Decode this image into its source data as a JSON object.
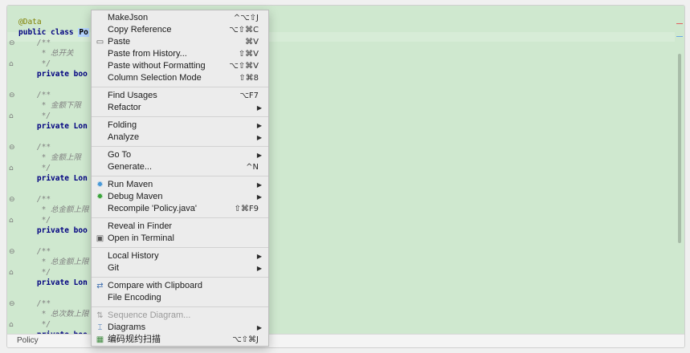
{
  "code": {
    "lines": [
      {
        "text": "@Data",
        "kind": "annotation"
      },
      {
        "text": "public class ",
        "kind": "kw",
        "highlight": "Po"
      },
      {
        "text": "    /**",
        "kind": "comment"
      },
      {
        "text": "     * 总开关",
        "kind": "comment"
      },
      {
        "text": "     */",
        "kind": "comment"
      },
      {
        "text": "    private boo",
        "kind": "kw"
      },
      {
        "text": "",
        "kind": "plain"
      },
      {
        "text": "    /**",
        "kind": "comment"
      },
      {
        "text": "     * 金额下限",
        "kind": "comment"
      },
      {
        "text": "     */",
        "kind": "comment"
      },
      {
        "text": "    private Lon",
        "kind": "kw"
      },
      {
        "text": "",
        "kind": "plain"
      },
      {
        "text": "    /**",
        "kind": "comment"
      },
      {
        "text": "     * 金额上限",
        "kind": "comment"
      },
      {
        "text": "     */",
        "kind": "comment"
      },
      {
        "text": "    private Lon",
        "kind": "kw"
      },
      {
        "text": "",
        "kind": "plain"
      },
      {
        "text": "    /**",
        "kind": "comment"
      },
      {
        "text": "     * 总金额上限",
        "kind": "comment"
      },
      {
        "text": "     */",
        "kind": "comment"
      },
      {
        "text": "    private boo",
        "kind": "kw"
      },
      {
        "text": "",
        "kind": "plain"
      },
      {
        "text": "    /**",
        "kind": "comment"
      },
      {
        "text": "     * 总金额上限",
        "kind": "comment"
      },
      {
        "text": "     */",
        "kind": "comment"
      },
      {
        "text": "    private Lon",
        "kind": "kw"
      },
      {
        "text": "",
        "kind": "plain"
      },
      {
        "text": "    /**",
        "kind": "comment"
      },
      {
        "text": "     * 总次数上限",
        "kind": "comment"
      },
      {
        "text": "     */",
        "kind": "comment"
      },
      {
        "text": "    private boo",
        "kind": "kw"
      }
    ]
  },
  "status": {
    "breadcrumb": "Policy"
  },
  "menu": {
    "items": [
      {
        "label": "MakeJson",
        "shortcut": "^⌥⇧J",
        "icon": ""
      },
      {
        "label": "Copy Reference",
        "shortcut": "⌥⇧⌘C",
        "icon": ""
      },
      {
        "label": "Paste",
        "shortcut": "⌘V",
        "icon": "clipboard-icon"
      },
      {
        "label": "Paste from History...",
        "shortcut": "⇧⌘V",
        "icon": ""
      },
      {
        "label": "Paste without Formatting",
        "shortcut": "⌥⇧⌘V",
        "icon": ""
      },
      {
        "label": "Column Selection Mode",
        "shortcut": "⇧⌘8",
        "icon": ""
      },
      {
        "sep": true
      },
      {
        "label": "Find Usages",
        "shortcut": "⌥F7",
        "icon": ""
      },
      {
        "label": "Refactor",
        "submenu": true,
        "icon": ""
      },
      {
        "sep": true
      },
      {
        "label": "Folding",
        "submenu": true,
        "icon": ""
      },
      {
        "label": "Analyze",
        "submenu": true,
        "icon": ""
      },
      {
        "sep": true
      },
      {
        "label": "Go To",
        "submenu": true,
        "icon": ""
      },
      {
        "label": "Generate...",
        "shortcut": "^N",
        "icon": ""
      },
      {
        "sep": true
      },
      {
        "label": "Run Maven",
        "submenu": true,
        "icon": "maven-run-icon"
      },
      {
        "label": "Debug Maven",
        "submenu": true,
        "icon": "maven-debug-icon"
      },
      {
        "label": "Recompile 'Policy.java'",
        "shortcut": "⇧⌘F9",
        "icon": ""
      },
      {
        "sep": true
      },
      {
        "label": "Reveal in Finder",
        "icon": ""
      },
      {
        "label": "Open in Terminal",
        "icon": "terminal-icon"
      },
      {
        "sep": true
      },
      {
        "label": "Local History",
        "submenu": true,
        "icon": ""
      },
      {
        "label": "Git",
        "submenu": true,
        "icon": ""
      },
      {
        "sep": true
      },
      {
        "label": "Compare with Clipboard",
        "icon": "compare-icon"
      },
      {
        "label": "File Encoding",
        "icon": ""
      },
      {
        "sep": true
      },
      {
        "label": "Sequence Diagram...",
        "icon": "sequence-diagram-icon",
        "disabled": true
      },
      {
        "label": "Diagrams",
        "submenu": true,
        "icon": "diagrams-icon"
      },
      {
        "label": "编码规约扫描",
        "shortcut": "⌥⇧⌘J",
        "icon": "scan-icon"
      }
    ]
  },
  "colors": {
    "editor_bg": "#cfe8cf",
    "menu_bg": "#ececec",
    "maven": "#4a9ad8",
    "debug": "#3aa43a"
  }
}
